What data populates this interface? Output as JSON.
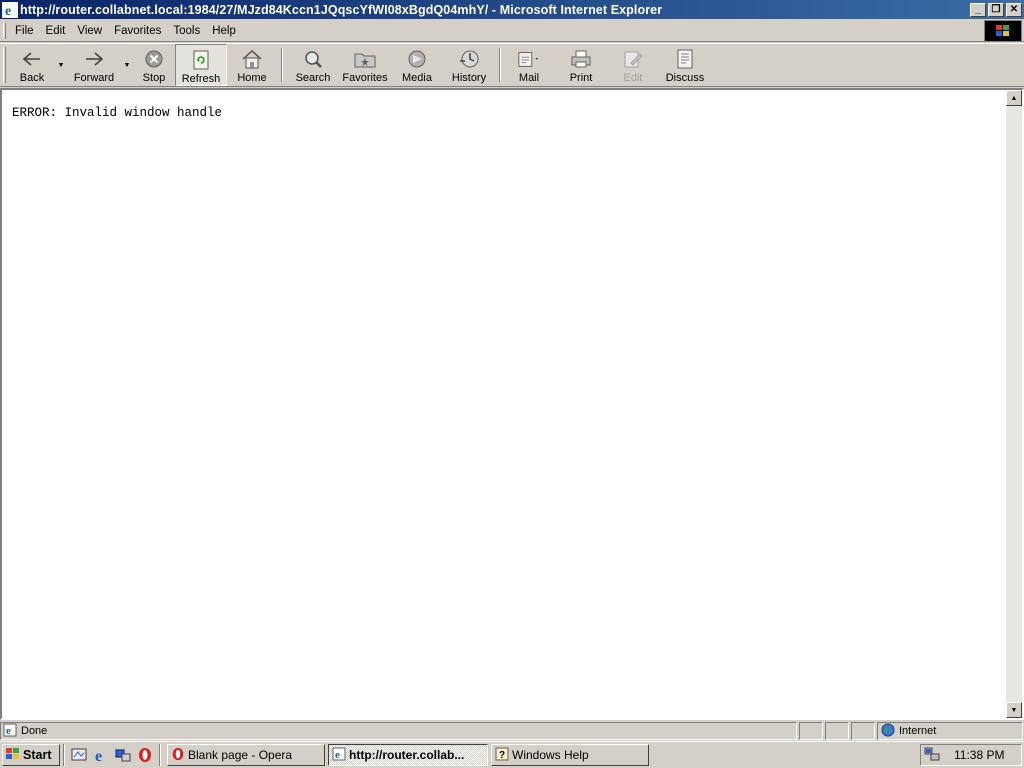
{
  "window": {
    "title": "http://router.collabnet.local:1984/27/MJzd84Kccn1JQqscYfWI08xBgdQ04mhY/ - Microsoft Internet Explorer",
    "minimize": "_",
    "maximize": "❐",
    "close": "✕"
  },
  "menu": {
    "items": [
      {
        "label": "File"
      },
      {
        "label": "Edit"
      },
      {
        "label": "View"
      },
      {
        "label": "Favorites"
      },
      {
        "label": "Tools"
      },
      {
        "label": "Help"
      }
    ]
  },
  "toolbar": {
    "back": "Back",
    "forward": "Forward",
    "stop": "Stop",
    "refresh": "Refresh",
    "home": "Home",
    "search": "Search",
    "favorites": "Favorites",
    "media": "Media",
    "history": "History",
    "mail": "Mail",
    "print": "Print",
    "edit": "Edit",
    "discuss": "Discuss"
  },
  "page": {
    "message": "ERROR: Invalid window handle"
  },
  "status": {
    "text": "Done",
    "zone": "Internet"
  },
  "taskbar": {
    "start": "Start",
    "tasks": [
      {
        "label": "Blank page - Opera"
      },
      {
        "label": "http://router.collab..."
      },
      {
        "label": "Windows Help"
      }
    ],
    "clock": "11:38 PM"
  },
  "colors": {
    "titlebar_start": "#0a246a",
    "titlebar_end": "#3a6ea5",
    "chrome": "#d4d0c8"
  }
}
